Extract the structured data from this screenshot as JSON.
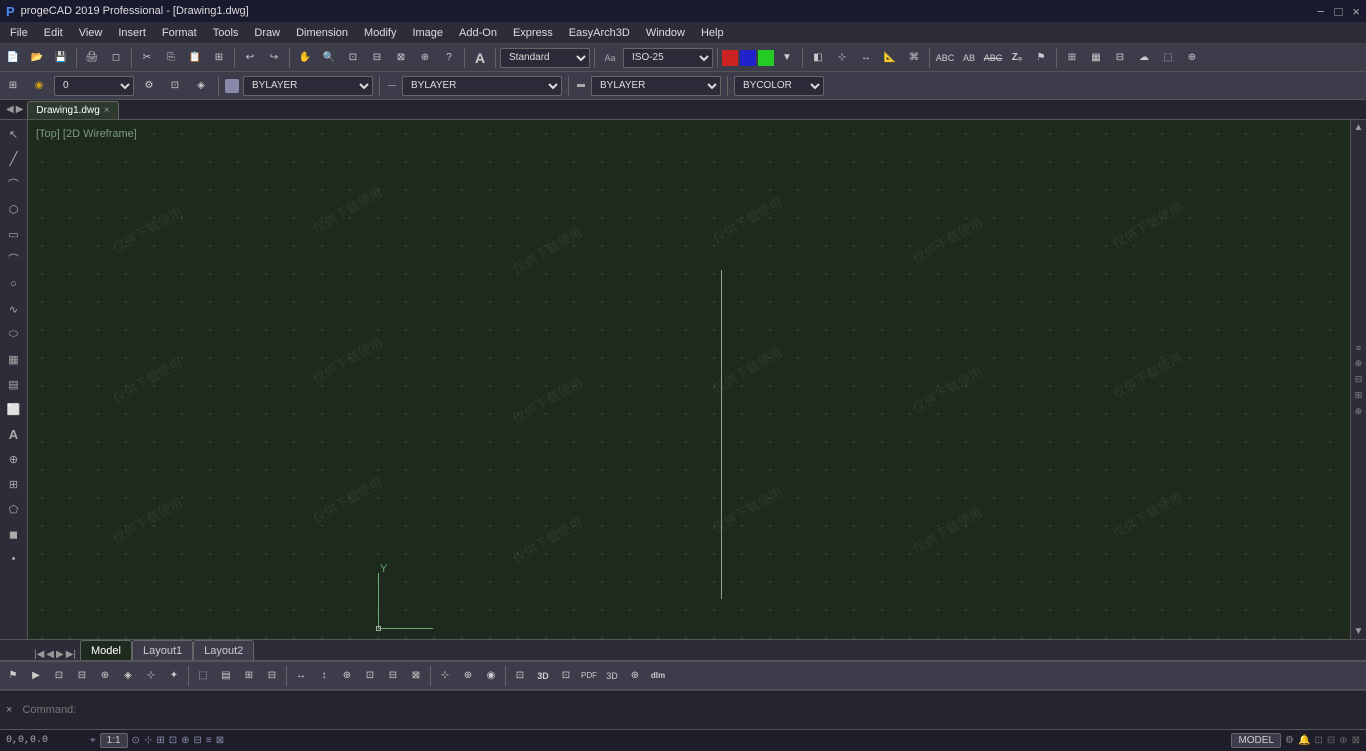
{
  "titlebar": {
    "title": "progeCAD 2019 Professional - [Drawing1.dwg]",
    "icon": "P",
    "controls": [
      "−",
      "□",
      "×"
    ]
  },
  "menubar": {
    "items": [
      "File",
      "Edit",
      "View",
      "Insert",
      "Format",
      "Tools",
      "Draw",
      "Dimension",
      "Modify",
      "Image",
      "Add-On",
      "Express",
      "EasyArch3D",
      "Window",
      "Help"
    ]
  },
  "toolbar1": {
    "text_style": "Standard",
    "font": "ISO-25"
  },
  "properties": {
    "layer": "0",
    "color_by": "BYLAYER",
    "linetype": "BYLAYER",
    "lineweight": "BYLAYER",
    "plotstyle": "BYCOLOR"
  },
  "viewport": {
    "label": "[Top] [2D Wireframe]"
  },
  "document_tab": {
    "name": "Drawing1.dwg",
    "close": "×"
  },
  "layout_tabs": {
    "model": "Model",
    "layout1": "Layout1",
    "layout2": "Layout2"
  },
  "statusbar": {
    "coords": "0,0,0.0",
    "scale": "1:1",
    "model": "MODEL"
  },
  "cmd_prompt": {
    "placeholder": "Command:"
  }
}
